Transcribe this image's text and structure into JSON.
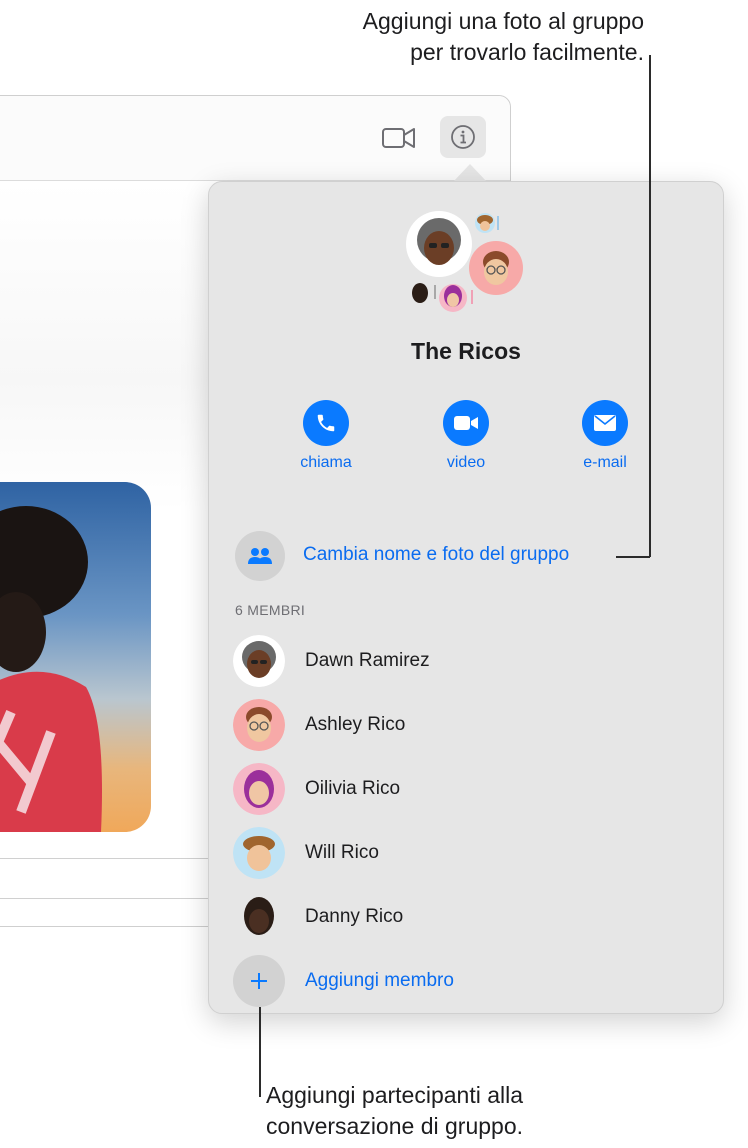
{
  "callouts": {
    "top_line1": "Aggiungi una foto al gruppo",
    "top_line2": "per trovarlo facilmente.",
    "bottom_line1": "Aggiungi partecipanti alla",
    "bottom_line2": "conversazione di gruppo."
  },
  "toolbar": {
    "video_icon": "video-camera-icon",
    "info_icon": "info-circle-icon"
  },
  "group": {
    "name": "The Ricos",
    "actions": [
      {
        "label": "chiama",
        "icon": "phone-icon"
      },
      {
        "label": "video",
        "icon": "video-camera-icon"
      },
      {
        "label": "e-mail",
        "icon": "envelope-icon"
      }
    ],
    "rename_label": "Cambia nome e foto del gruppo",
    "members_header": "6 MEMBRI",
    "members": [
      {
        "name": "Dawn Ramirez"
      },
      {
        "name": "Ashley Rico"
      },
      {
        "name": "Oilivia Rico"
      },
      {
        "name": "Will Rico"
      },
      {
        "name": "Danny Rico"
      }
    ],
    "add_member_label": "Aggiungi membro"
  },
  "colors": {
    "accent": "#0a7aff",
    "link": "#0a6cf0",
    "popover_bg": "#e6e6e6"
  }
}
